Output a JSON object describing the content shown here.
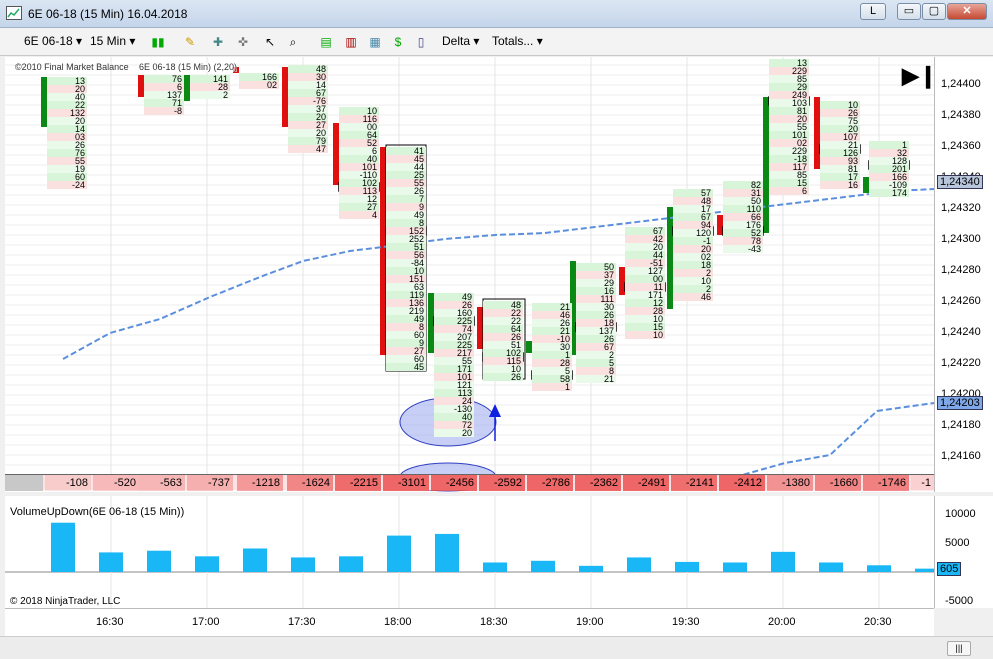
{
  "window": {
    "title": "6E 06-18 (15 Min)  16.04.2018",
    "btn_l": "L",
    "btn_min": "▭",
    "btn_max": "▢",
    "btn_close": "✕"
  },
  "toolbar": {
    "instrument": "6E 06-18",
    "interval": "15 Min",
    "delta_menu": "Delta",
    "totals_menu": "Totals..."
  },
  "chart": {
    "copyright_top": "©2010 Final Market Balance",
    "series_label": "6E 06-18 (15 Min) (2,20)",
    "price_axis_labels": [
      "1,24400",
      "1,24380",
      "1,24360",
      "1,24340",
      "1,24320",
      "1,24300",
      "1,24280",
      "1,24260",
      "1,24240",
      "1,24220",
      "1,24200",
      "1,24180",
      "1,24160"
    ],
    "current_price_tag": "1,24340",
    "vwap_price_tag": "1,24203",
    "delta_row": [
      "-108",
      "-520",
      "-563",
      "-737",
      "-1218",
      "-1624",
      "-2215",
      "-3101",
      "-2456",
      "-2592",
      "-2786",
      "-2362",
      "-2491",
      "-2141",
      "-2412",
      "-1380",
      "-1660",
      "-1746",
      "-1"
    ],
    "footprint_columns": [
      {
        "cells": [
          [
            "",
            "13"
          ],
          [
            "",
            "20"
          ],
          [
            "",
            "40"
          ],
          [
            "",
            "22"
          ],
          [
            "",
            "132"
          ],
          [
            "",
            "20"
          ],
          [
            "",
            "14"
          ],
          [
            "",
            "03"
          ],
          [
            "",
            "26"
          ],
          [
            "",
            "76"
          ],
          [
            "",
            "55"
          ],
          [
            "",
            "19"
          ],
          [
            "",
            "60"
          ],
          [
            "",
            "-24"
          ]
        ]
      },
      {
        "cells": [
          [
            "",
            "76"
          ],
          [
            "",
            "6"
          ],
          [
            "",
            "137"
          ],
          [
            "",
            "71"
          ],
          [
            "",
            "-8"
          ]
        ]
      },
      {
        "cells": [
          [
            "",
            "141"
          ],
          [
            "",
            "28"
          ],
          [
            "",
            "2"
          ]
        ]
      },
      {
        "cells": [
          [
            "",
            "166"
          ],
          [
            "",
            "02"
          ]
        ]
      },
      {
        "cells": [
          [
            "",
            "48"
          ],
          [
            "",
            "30"
          ],
          [
            "",
            "14"
          ],
          [
            "",
            "67"
          ],
          [
            "",
            "-76"
          ],
          [
            "",
            "37"
          ],
          [
            "",
            "20"
          ],
          [
            "",
            "27"
          ],
          [
            "",
            "20"
          ],
          [
            "",
            "79"
          ],
          [
            "",
            "47"
          ]
        ]
      },
      {
        "cells": [
          [
            "",
            "10"
          ],
          [
            "",
            "116"
          ],
          [
            "",
            "00"
          ],
          [
            "",
            "64"
          ],
          [
            "",
            "52"
          ],
          [
            "",
            "6"
          ],
          [
            "",
            "40"
          ],
          [
            "",
            "101"
          ],
          [
            "",
            "-110"
          ],
          [
            "",
            "102"
          ],
          [
            "",
            "113"
          ],
          [
            "",
            "12"
          ],
          [
            "",
            "27"
          ],
          [
            "",
            "4"
          ]
        ]
      },
      {
        "cells": [
          [
            "",
            "41"
          ],
          [
            "",
            "45"
          ],
          [
            "",
            "44"
          ],
          [
            "",
            "25"
          ],
          [
            "",
            "55"
          ],
          [
            "",
            "26"
          ],
          [
            "",
            "7"
          ],
          [
            "",
            "9"
          ],
          [
            "",
            "49"
          ],
          [
            "",
            "8"
          ],
          [
            "",
            "152"
          ],
          [
            "",
            "252"
          ],
          [
            "",
            "51"
          ],
          [
            "",
            "56"
          ],
          [
            "",
            "-84"
          ],
          [
            "",
            "10"
          ],
          [
            "",
            "151"
          ],
          [
            "",
            "63"
          ],
          [
            "",
            "119"
          ],
          [
            "",
            "136"
          ],
          [
            "",
            "219"
          ],
          [
            "",
            "49"
          ],
          [
            "",
            "8"
          ],
          [
            "",
            "60"
          ],
          [
            "",
            "9"
          ],
          [
            "",
            "27"
          ],
          [
            "",
            "60"
          ],
          [
            "",
            "45"
          ]
        ]
      },
      {
        "cells": [
          [
            "",
            "49"
          ],
          [
            "",
            "26"
          ],
          [
            "",
            "160"
          ],
          [
            "",
            "225"
          ],
          [
            "",
            "74"
          ],
          [
            "",
            "207"
          ],
          [
            "",
            "225"
          ],
          [
            "",
            "217"
          ],
          [
            "",
            "55"
          ],
          [
            "",
            "171"
          ],
          [
            "",
            "101"
          ],
          [
            "",
            "121"
          ],
          [
            "",
            "113"
          ],
          [
            "",
            "24"
          ],
          [
            "",
            "-130"
          ],
          [
            "",
            "40"
          ],
          [
            "",
            "72"
          ],
          [
            "",
            "20"
          ]
        ]
      },
      {
        "cells": [
          [
            "",
            "48"
          ],
          [
            "",
            "22"
          ],
          [
            "",
            "22"
          ],
          [
            "",
            "64"
          ],
          [
            "",
            "26"
          ],
          [
            "",
            "51"
          ],
          [
            "",
            "102"
          ],
          [
            "",
            "115"
          ],
          [
            "",
            "10"
          ],
          [
            "",
            "26"
          ]
        ]
      },
      {
        "cells": [
          [
            "",
            "21"
          ],
          [
            "",
            "46"
          ],
          [
            "",
            "26"
          ],
          [
            "",
            "21"
          ],
          [
            "",
            "-10"
          ],
          [
            "",
            "30"
          ],
          [
            "",
            "1"
          ],
          [
            "",
            "28"
          ],
          [
            "",
            "5"
          ],
          [
            "",
            "58"
          ],
          [
            "",
            "1"
          ]
        ]
      },
      {
        "cells": [
          [
            "",
            "50"
          ],
          [
            "",
            "37"
          ],
          [
            "",
            "29"
          ],
          [
            "",
            "16"
          ],
          [
            "",
            "111"
          ],
          [
            "",
            "30"
          ],
          [
            "",
            "26"
          ],
          [
            "",
            "18"
          ],
          [
            "",
            "137"
          ],
          [
            "",
            "26"
          ],
          [
            "",
            "67"
          ],
          [
            "",
            "2"
          ],
          [
            "",
            "5"
          ],
          [
            "",
            "8"
          ],
          [
            "",
            "21"
          ]
        ]
      },
      {
        "cells": [
          [
            "",
            "67"
          ],
          [
            "",
            "42"
          ],
          [
            "",
            "20"
          ],
          [
            "",
            "44"
          ],
          [
            "",
            "-51"
          ],
          [
            "",
            "127"
          ],
          [
            "",
            "00"
          ],
          [
            "",
            "11"
          ],
          [
            "",
            "171"
          ],
          [
            "",
            "12"
          ],
          [
            "",
            "28"
          ],
          [
            "",
            "10"
          ],
          [
            "",
            "15"
          ],
          [
            "",
            "10"
          ]
        ]
      },
      {
        "cells": [
          [
            "",
            "57"
          ],
          [
            "",
            "48"
          ],
          [
            "",
            "17"
          ],
          [
            "",
            "67"
          ],
          [
            "",
            "94"
          ],
          [
            "",
            "120"
          ],
          [
            "",
            "-1"
          ],
          [
            "",
            "20"
          ],
          [
            "",
            "02"
          ],
          [
            "",
            "18"
          ],
          [
            "",
            "2"
          ],
          [
            "",
            "10"
          ],
          [
            "",
            "2"
          ],
          [
            "",
            "46"
          ]
        ]
      },
      {
        "cells": [
          [
            "",
            "82"
          ],
          [
            "",
            "31"
          ],
          [
            "",
            "50"
          ],
          [
            "",
            "110"
          ],
          [
            "",
            "66"
          ],
          [
            "",
            "176"
          ],
          [
            "",
            "52"
          ],
          [
            "",
            "78"
          ],
          [
            "",
            "-43"
          ]
        ]
      },
      {
        "cells": [
          [
            "",
            "13"
          ],
          [
            "",
            "229"
          ],
          [
            "",
            "85"
          ],
          [
            "",
            "29"
          ],
          [
            "",
            "249"
          ],
          [
            "",
            "103"
          ],
          [
            "",
            "81"
          ],
          [
            "",
            "20"
          ],
          [
            "",
            "55"
          ],
          [
            "",
            "101"
          ],
          [
            "",
            "02"
          ],
          [
            "",
            "229"
          ],
          [
            "",
            "-18"
          ],
          [
            "",
            "117"
          ],
          [
            "",
            "85"
          ],
          [
            "",
            "15"
          ],
          [
            "",
            "6"
          ]
        ]
      },
      {
        "cells": [
          [
            "",
            "10"
          ],
          [
            "",
            "26"
          ],
          [
            "",
            "75"
          ],
          [
            "",
            "20"
          ],
          [
            "",
            "107"
          ],
          [
            "",
            "21"
          ],
          [
            "",
            "126"
          ],
          [
            "",
            "93"
          ],
          [
            "",
            "81"
          ],
          [
            "",
            "17"
          ],
          [
            "",
            "16"
          ]
        ]
      },
      {
        "cells": [
          [
            "",
            "1"
          ],
          [
            "",
            "32"
          ],
          [
            "",
            "128"
          ],
          [
            "",
            "201"
          ],
          [
            "",
            "166"
          ],
          [
            "",
            "-109"
          ],
          [
            "",
            "174"
          ]
        ]
      }
    ]
  },
  "indicator": {
    "label": "VolumeUpDown(6E 06-18 (15 Min))",
    "axis_labels": [
      "10000",
      "5000",
      "0",
      "-5000"
    ],
    "last_value_tag": "605",
    "copyright": "© 2018 NinjaTrader, LLC"
  },
  "time_axis": [
    "16:30",
    "17:00",
    "17:30",
    "18:00",
    "18:30",
    "19:00",
    "19:30",
    "20:00",
    "20:30"
  ],
  "colors": {
    "bull_bar": "#0a8a14",
    "bear_bar": "#e01010",
    "vwap_line": "#5b8fdd",
    "volume_bar": "#19b7f5",
    "delta_bg": "#f5b5b5",
    "ellipse_fill": "#9aa8f0"
  },
  "icons": [
    "app-icon",
    "bar-chart-icon",
    "pencil-icon",
    "crosshair-icon",
    "cursor-icon",
    "zoom-icon",
    "data-box-icon",
    "strategy-icon",
    "properties-icon",
    "play-end-icon",
    "arrow-up-icon"
  ]
}
